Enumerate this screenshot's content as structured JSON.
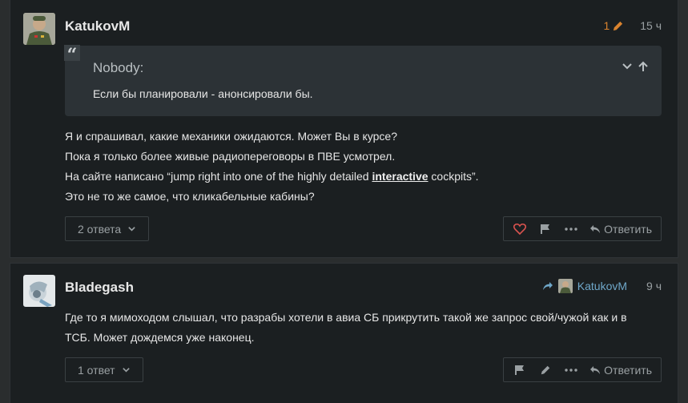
{
  "posts": [
    {
      "username": "KatukovM",
      "edit_count": "1",
      "time": "15 ч",
      "quote": {
        "author": "Nobody:",
        "text": "Если бы планировали - анонсировали бы."
      },
      "body": {
        "line1": "Я и спрашивал, какие механики ожидаются. Может Вы в курсе?",
        "line2": "Пока я только более живые радиопереговоры в ПВЕ усмотрел.",
        "line3_pre": "На сайте написано “jump right into one of the highly detailed ",
        "line3_link": "interactive",
        "line3_post": " cockpits”.",
        "line4": "Это не то же самое, что кликабельные кабины?"
      },
      "replies_label": "2 ответа",
      "reply_label": "Ответить"
    },
    {
      "username": "Bladegash",
      "reply_to": "KatukovM",
      "time": "9 ч",
      "body": {
        "line1": "Где то я мимоходом слышал, что разрабы хотели в авиа СБ прикрутить такой же запрос свой/чужой как и в",
        "line2": "ТСБ. Может дождемся уже наконец."
      },
      "replies_label": "1 ответ",
      "reply_label": "Ответить"
    }
  ],
  "icons": {
    "edit": "pencil-icon",
    "expand": "chevron-down-icon",
    "up": "arrow-up-icon",
    "like": "heart-icon",
    "flag": "flag-icon",
    "more": "more-icon",
    "reply": "reply-icon",
    "reply_to": "share-arrow-icon"
  },
  "colors": {
    "background": "#1b1f21",
    "accent_orange": "#d9832f",
    "like_red": "#d9534f",
    "link_blue": "#6fa7c9"
  }
}
